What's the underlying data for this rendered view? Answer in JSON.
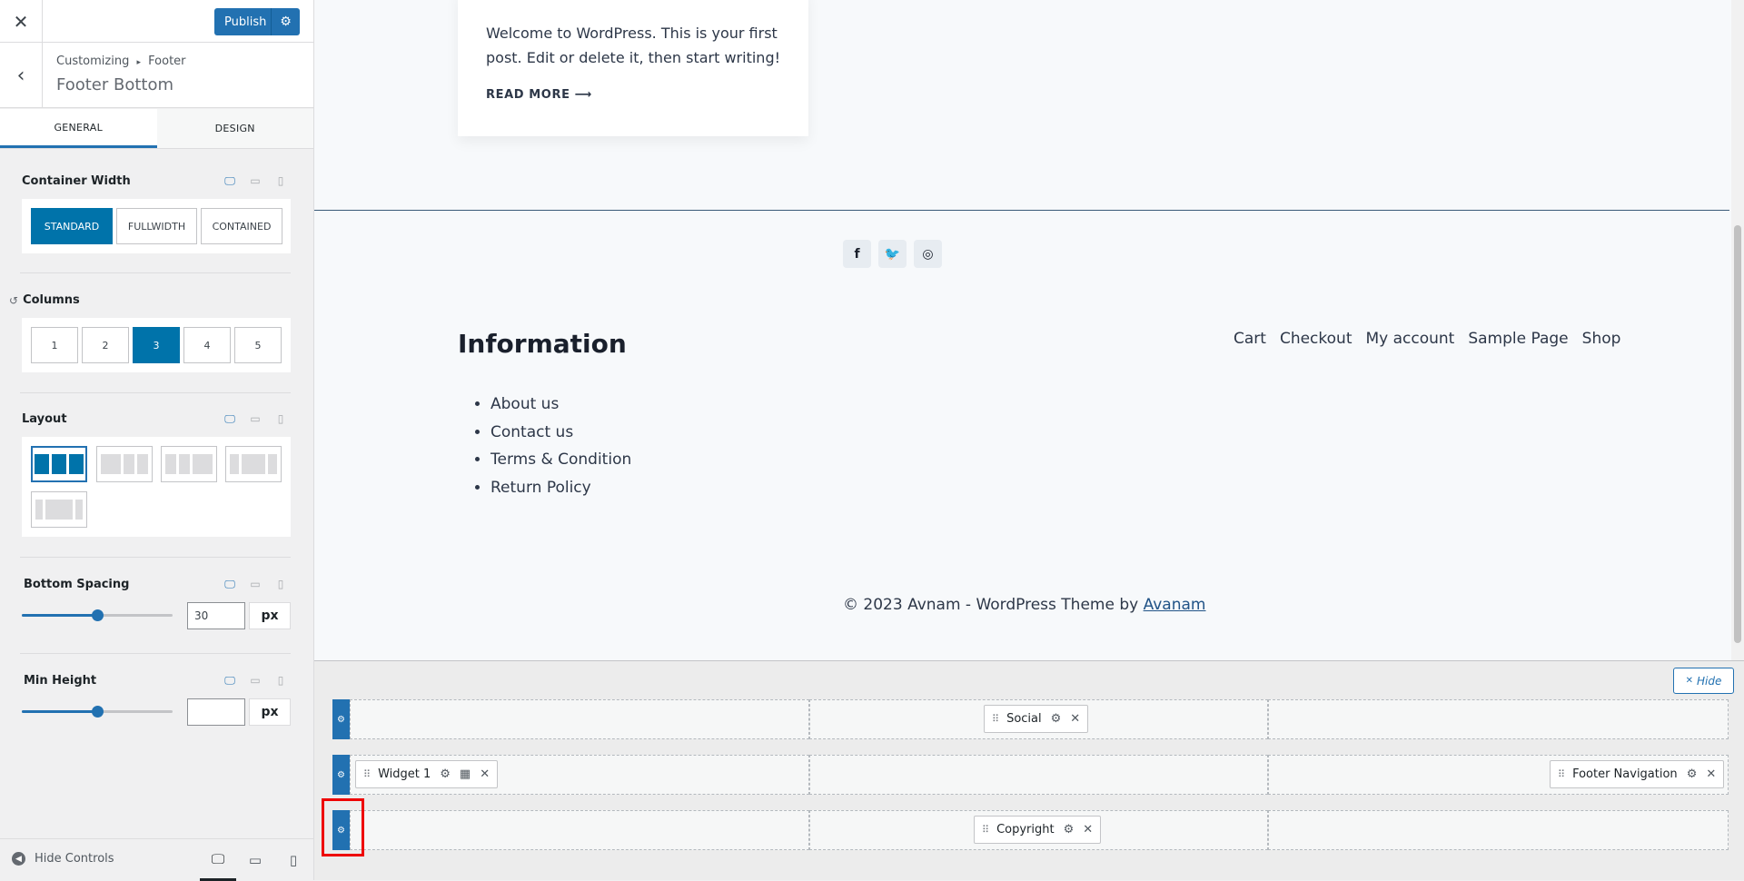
{
  "topbar": {
    "publish_label": "Publish"
  },
  "section": {
    "breadcrumb_root": "Customizing",
    "breadcrumb_sep": "▸",
    "breadcrumb_parent": "Footer",
    "title": "Footer Bottom"
  },
  "tabs": [
    {
      "label": "GENERAL"
    },
    {
      "label": "DESIGN"
    }
  ],
  "controls": {
    "container_width": {
      "label": "Container Width",
      "options": [
        "STANDARD",
        "FULLWIDTH",
        "CONTAINED"
      ],
      "selected": "STANDARD"
    },
    "columns": {
      "label": "Columns",
      "options": [
        "1",
        "2",
        "3",
        "4",
        "5"
      ],
      "selected": "3"
    },
    "layout": {
      "label": "Layout"
    },
    "bottom_spacing": {
      "label": "Bottom Spacing",
      "value": "30",
      "unit": "px",
      "slider_fraction": 0.5
    },
    "min_height": {
      "label": "Min Height",
      "value": "",
      "unit": "px",
      "slider_fraction": 0.5
    }
  },
  "bottombar": {
    "hide_controls": "Hide Controls"
  },
  "preview": {
    "post_excerpt": "Welcome to WordPress. This is your first post. Edit or delete it, then start writing!",
    "read_more": "READ MORE ⟶",
    "info_title": "Information",
    "info_links": [
      "About us",
      "Contact us",
      "Terms & Condition",
      "Return Policy"
    ],
    "nav_links": [
      "Cart",
      "Checkout",
      "My account",
      "Sample Page",
      "Shop"
    ],
    "copyright_text": "© 2023 Avnam - WordPress Theme by ",
    "copyright_link": "Avanam"
  },
  "builder": {
    "hide_label": "Hide",
    "rows": [
      {
        "items": [
          {
            "column": 2,
            "label": "Social"
          }
        ]
      },
      {
        "items": [
          {
            "column": 1,
            "label": "Widget 1"
          },
          {
            "column": 3,
            "label": "Footer Navigation"
          }
        ]
      },
      {
        "items": [
          {
            "column": 2,
            "label": "Copyright"
          }
        ]
      }
    ]
  },
  "colors": {
    "accent": "#2271b1",
    "highlight": "#e00000"
  }
}
